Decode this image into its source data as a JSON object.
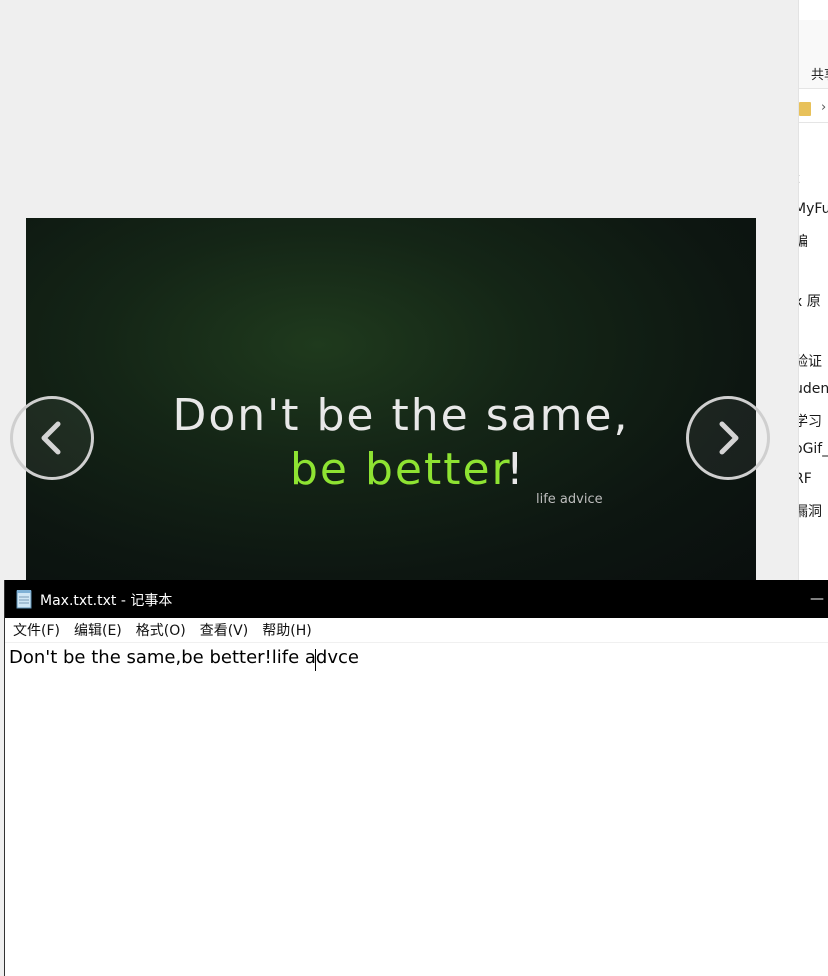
{
  "explorer": {
    "ribbon_tab": "共享",
    "address_sep": "›",
    "files": [
      "t",
      "MyFu",
      "编",
      "x 原",
      "验证",
      "uden",
      "学习",
      "oGif_",
      "RF",
      "漏洞"
    ]
  },
  "viewer": {
    "quote_line1": "Don't be the same,",
    "quote_line2": "be better",
    "quote_bang": "!",
    "quote_caption": "life advice",
    "prev_icon": "chevron-left-icon",
    "next_icon": "chevron-right-icon",
    "colors": {
      "accent_green": "#8ee332",
      "text_light": "#e8e8e8"
    }
  },
  "notepad": {
    "title": "Max.txt.txt - 记事本",
    "minimize_label": "—",
    "menu": [
      "文件(F)",
      "编辑(E)",
      "格式(O)",
      "查看(V)",
      "帮助(H)"
    ],
    "content": "Don't be the same,be better!life advce"
  }
}
